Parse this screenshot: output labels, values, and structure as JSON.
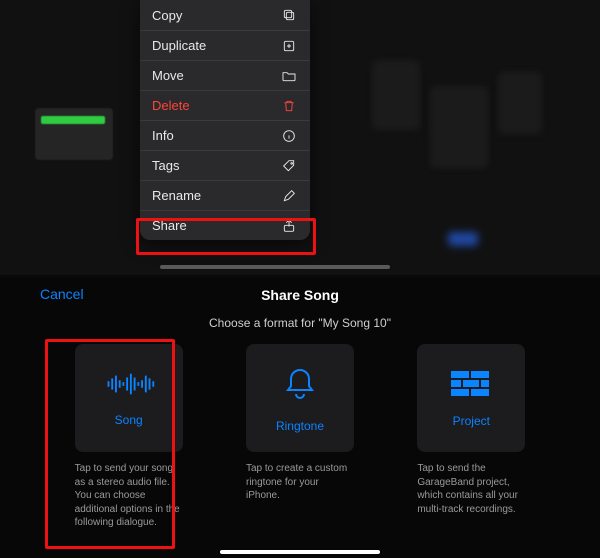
{
  "menu": {
    "items": [
      {
        "label": "Copy",
        "icon": "copy-icon",
        "destructive": false
      },
      {
        "label": "Duplicate",
        "icon": "duplicate-icon",
        "destructive": false
      },
      {
        "label": "Move",
        "icon": "folder-icon",
        "destructive": false
      },
      {
        "label": "Delete",
        "icon": "trash-icon",
        "destructive": true
      },
      {
        "label": "Info",
        "icon": "info-icon",
        "destructive": false
      },
      {
        "label": "Tags",
        "icon": "tag-icon",
        "destructive": false
      },
      {
        "label": "Rename",
        "icon": "pencil-icon",
        "destructive": false
      },
      {
        "label": "Share",
        "icon": "share-icon",
        "destructive": false
      }
    ]
  },
  "sheet": {
    "cancel": "Cancel",
    "title": "Share Song",
    "subtitle": "Choose a format for \"My Song 10\"",
    "options": [
      {
        "name": "Song",
        "icon": "waveform-icon",
        "description": "Tap to send your song as a stereo audio file. You can choose additional options in the following dialogue."
      },
      {
        "name": "Ringtone",
        "icon": "bell-icon",
        "description": "Tap to create a custom ringtone for your iPhone."
      },
      {
        "name": "Project",
        "icon": "bricks-icon",
        "description": "Tap to send the GarageBand project, which contains all your multi-track recordings."
      }
    ]
  },
  "colors": {
    "accent": "#0a84ff",
    "destructive": "#ff453a",
    "highlight": "#e11"
  }
}
